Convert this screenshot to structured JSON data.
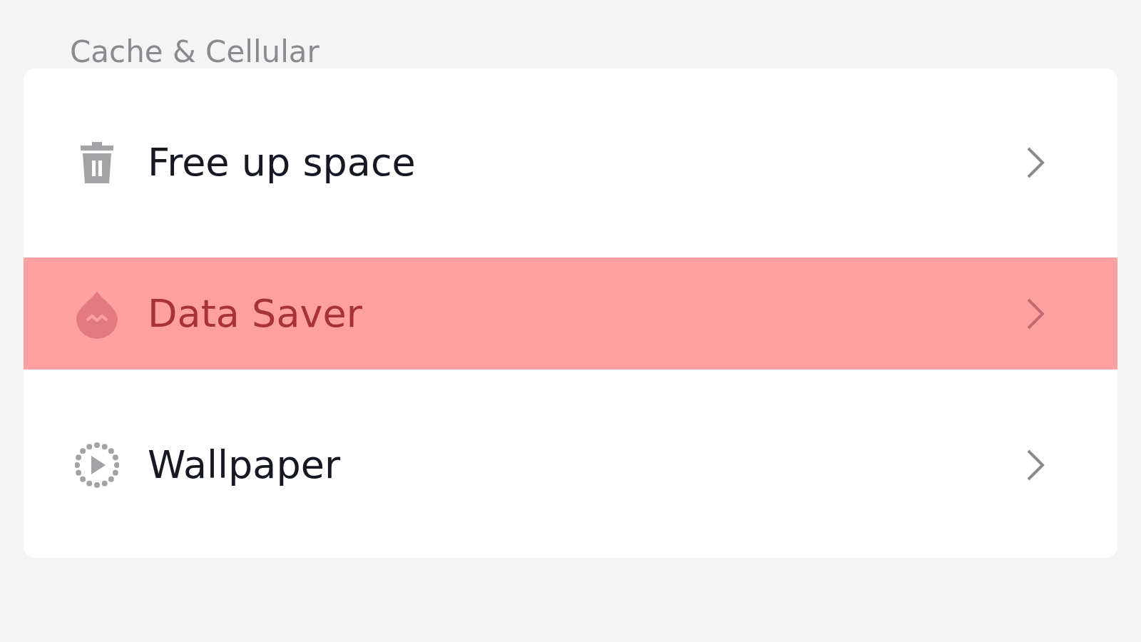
{
  "section_title": "Cache & Cellular",
  "items": [
    {
      "label": "Free up space",
      "kind": "trash",
      "selected": false
    },
    {
      "label": "Data Saver",
      "kind": "drop",
      "selected": true
    },
    {
      "label": "Wallpaper",
      "kind": "play",
      "selected": false
    }
  ]
}
